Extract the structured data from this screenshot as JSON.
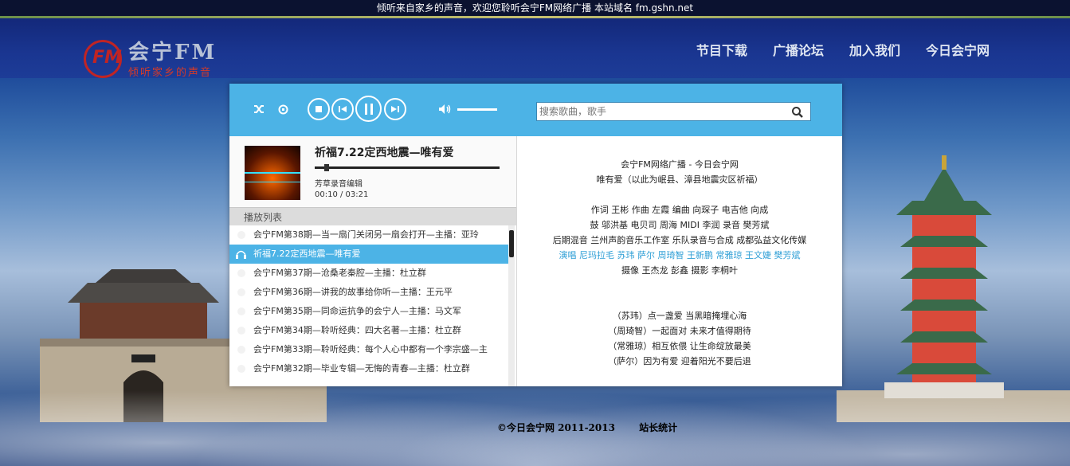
{
  "topbar": {
    "text": "倾听来自家乡的声音，欢迎您聆听会宁FM网络广播  本站域名 fm.gshn.net"
  },
  "logo": {
    "title": "会宁FM",
    "subtitle": "倾听家乡的声音",
    "mark_text": "FM"
  },
  "nav": {
    "items": [
      {
        "label": "节目下载"
      },
      {
        "label": "广播论坛"
      },
      {
        "label": "加入我们"
      },
      {
        "label": "今日会宁网"
      }
    ]
  },
  "search": {
    "placeholder": "搜索歌曲，歌手"
  },
  "now_playing": {
    "title": "祈福7.22定西地震—唯有爱",
    "artist": "芳草录音编辑",
    "time": "00:10 / 03:21",
    "progress": 0.05
  },
  "volume": 0.7,
  "playlist": {
    "header": "播放列表",
    "items": [
      {
        "label": "会宁FM第38期—当一扇门关闭另一扇会打开—主播：亚玲",
        "active": false
      },
      {
        "label": "祈福7.22定西地震—唯有爱",
        "active": true
      },
      {
        "label": "会宁FM第37期—沧桑老秦腔—主播：杜立群",
        "active": false
      },
      {
        "label": "会宁FM第36期—讲我的故事给你听—主播：王元平",
        "active": false
      },
      {
        "label": "会宁FM第35期—同命运抗争的会宁人—主播：马文军",
        "active": false
      },
      {
        "label": "会宁FM第34期—聆听经典：四大名著—主播：杜立群",
        "active": false
      },
      {
        "label": "会宁FM第33期—聆听经典：每个人心中都有一个李宗盛—主",
        "active": false
      },
      {
        "label": "会宁FM第32期—毕业专辑—无悔的青春—主播：杜立群",
        "active": false
      }
    ]
  },
  "lyrics": [
    {
      "text": "会宁FM网络广播 - 今日会宁网",
      "hl": false
    },
    {
      "text": "唯有爱（以此为岷县、漳县地震灾区祈福）",
      "hl": false
    },
    {
      "text": "",
      "hl": false
    },
    {
      "text": "作词 王彬  作曲 左霞  编曲 向琛子  电吉他 向成",
      "hl": false
    },
    {
      "text": "鼓 邬洪基  电贝司 周海  MIDI 李润  录音 樊芳斌",
      "hl": false
    },
    {
      "text": "后期混音 兰州声韵音乐工作室  乐队录音与合成 成都弘益文化传媒",
      "hl": false
    },
    {
      "text": "演唱 尼玛拉毛 苏玮 萨尔 周琦智 王新鹏 常雅琼 王文婕 樊芳斌",
      "hl": true
    },
    {
      "text": "摄像 王杰龙 彭鑫 摄影 李桐叶",
      "hl": false
    },
    {
      "text": "",
      "hl": false
    },
    {
      "text": "",
      "hl": false
    },
    {
      "text": "（苏玮）点一盏爱 当黑暗掩埋心海",
      "hl": false
    },
    {
      "text": "（周琦智）一起面对 未来才值得期待",
      "hl": false
    },
    {
      "text": "（常雅琼）相互依偎 让生命绽放最美",
      "hl": false
    },
    {
      "text": "（萨尔）因为有爱 迎着阳光不要后退",
      "hl": false
    }
  ],
  "footer": {
    "copyright": "©今日会宁网  2011-2013",
    "stats": "站长统计"
  },
  "colors": {
    "accent": "#4cb3e6",
    "highlight_text": "#2f9fd6",
    "logo_red": "#c02424"
  }
}
